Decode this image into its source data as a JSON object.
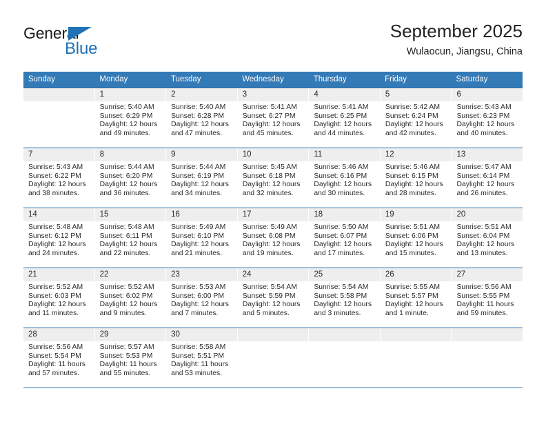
{
  "logo": {
    "word_top": "General",
    "word_bottom": "Blue",
    "triangle_icon": "triangle-icon",
    "accent_color": "#1f72b8"
  },
  "header": {
    "title": "September 2025",
    "subtitle": "Wulaocun, Jiangsu, China"
  },
  "theme": {
    "header_bg": "#337ab7",
    "row_border": "#2b6ea8",
    "day_band_bg": "#eeeeee",
    "text": "#2b2b2b"
  },
  "weekdays": [
    "Sunday",
    "Monday",
    "Tuesday",
    "Wednesday",
    "Thursday",
    "Friday",
    "Saturday"
  ],
  "weeks": [
    {
      "days": [
        {
          "number": "",
          "sunrise": "",
          "sunset": "",
          "daylight_line1": "",
          "daylight_line2": "",
          "empty": true
        },
        {
          "number": "1",
          "sunrise": "Sunrise: 5:40 AM",
          "sunset": "Sunset: 6:29 PM",
          "daylight_line1": "Daylight: 12 hours",
          "daylight_line2": "and 49 minutes."
        },
        {
          "number": "2",
          "sunrise": "Sunrise: 5:40 AM",
          "sunset": "Sunset: 6:28 PM",
          "daylight_line1": "Daylight: 12 hours",
          "daylight_line2": "and 47 minutes."
        },
        {
          "number": "3",
          "sunrise": "Sunrise: 5:41 AM",
          "sunset": "Sunset: 6:27 PM",
          "daylight_line1": "Daylight: 12 hours",
          "daylight_line2": "and 45 minutes."
        },
        {
          "number": "4",
          "sunrise": "Sunrise: 5:41 AM",
          "sunset": "Sunset: 6:25 PM",
          "daylight_line1": "Daylight: 12 hours",
          "daylight_line2": "and 44 minutes."
        },
        {
          "number": "5",
          "sunrise": "Sunrise: 5:42 AM",
          "sunset": "Sunset: 6:24 PM",
          "daylight_line1": "Daylight: 12 hours",
          "daylight_line2": "and 42 minutes."
        },
        {
          "number": "6",
          "sunrise": "Sunrise: 5:43 AM",
          "sunset": "Sunset: 6:23 PM",
          "daylight_line1": "Daylight: 12 hours",
          "daylight_line2": "and 40 minutes."
        }
      ]
    },
    {
      "days": [
        {
          "number": "7",
          "sunrise": "Sunrise: 5:43 AM",
          "sunset": "Sunset: 6:22 PM",
          "daylight_line1": "Daylight: 12 hours",
          "daylight_line2": "and 38 minutes."
        },
        {
          "number": "8",
          "sunrise": "Sunrise: 5:44 AM",
          "sunset": "Sunset: 6:20 PM",
          "daylight_line1": "Daylight: 12 hours",
          "daylight_line2": "and 36 minutes."
        },
        {
          "number": "9",
          "sunrise": "Sunrise: 5:44 AM",
          "sunset": "Sunset: 6:19 PM",
          "daylight_line1": "Daylight: 12 hours",
          "daylight_line2": "and 34 minutes."
        },
        {
          "number": "10",
          "sunrise": "Sunrise: 5:45 AM",
          "sunset": "Sunset: 6:18 PM",
          "daylight_line1": "Daylight: 12 hours",
          "daylight_line2": "and 32 minutes."
        },
        {
          "number": "11",
          "sunrise": "Sunrise: 5:46 AM",
          "sunset": "Sunset: 6:16 PM",
          "daylight_line1": "Daylight: 12 hours",
          "daylight_line2": "and 30 minutes."
        },
        {
          "number": "12",
          "sunrise": "Sunrise: 5:46 AM",
          "sunset": "Sunset: 6:15 PM",
          "daylight_line1": "Daylight: 12 hours",
          "daylight_line2": "and 28 minutes."
        },
        {
          "number": "13",
          "sunrise": "Sunrise: 5:47 AM",
          "sunset": "Sunset: 6:14 PM",
          "daylight_line1": "Daylight: 12 hours",
          "daylight_line2": "and 26 minutes."
        }
      ]
    },
    {
      "days": [
        {
          "number": "14",
          "sunrise": "Sunrise: 5:48 AM",
          "sunset": "Sunset: 6:12 PM",
          "daylight_line1": "Daylight: 12 hours",
          "daylight_line2": "and 24 minutes."
        },
        {
          "number": "15",
          "sunrise": "Sunrise: 5:48 AM",
          "sunset": "Sunset: 6:11 PM",
          "daylight_line1": "Daylight: 12 hours",
          "daylight_line2": "and 22 minutes."
        },
        {
          "number": "16",
          "sunrise": "Sunrise: 5:49 AM",
          "sunset": "Sunset: 6:10 PM",
          "daylight_line1": "Daylight: 12 hours",
          "daylight_line2": "and 21 minutes."
        },
        {
          "number": "17",
          "sunrise": "Sunrise: 5:49 AM",
          "sunset": "Sunset: 6:08 PM",
          "daylight_line1": "Daylight: 12 hours",
          "daylight_line2": "and 19 minutes."
        },
        {
          "number": "18",
          "sunrise": "Sunrise: 5:50 AM",
          "sunset": "Sunset: 6:07 PM",
          "daylight_line1": "Daylight: 12 hours",
          "daylight_line2": "and 17 minutes."
        },
        {
          "number": "19",
          "sunrise": "Sunrise: 5:51 AM",
          "sunset": "Sunset: 6:06 PM",
          "daylight_line1": "Daylight: 12 hours",
          "daylight_line2": "and 15 minutes."
        },
        {
          "number": "20",
          "sunrise": "Sunrise: 5:51 AM",
          "sunset": "Sunset: 6:04 PM",
          "daylight_line1": "Daylight: 12 hours",
          "daylight_line2": "and 13 minutes."
        }
      ]
    },
    {
      "days": [
        {
          "number": "21",
          "sunrise": "Sunrise: 5:52 AM",
          "sunset": "Sunset: 6:03 PM",
          "daylight_line1": "Daylight: 12 hours",
          "daylight_line2": "and 11 minutes."
        },
        {
          "number": "22",
          "sunrise": "Sunrise: 5:52 AM",
          "sunset": "Sunset: 6:02 PM",
          "daylight_line1": "Daylight: 12 hours",
          "daylight_line2": "and 9 minutes."
        },
        {
          "number": "23",
          "sunrise": "Sunrise: 5:53 AM",
          "sunset": "Sunset: 6:00 PM",
          "daylight_line1": "Daylight: 12 hours",
          "daylight_line2": "and 7 minutes."
        },
        {
          "number": "24",
          "sunrise": "Sunrise: 5:54 AM",
          "sunset": "Sunset: 5:59 PM",
          "daylight_line1": "Daylight: 12 hours",
          "daylight_line2": "and 5 minutes."
        },
        {
          "number": "25",
          "sunrise": "Sunrise: 5:54 AM",
          "sunset": "Sunset: 5:58 PM",
          "daylight_line1": "Daylight: 12 hours",
          "daylight_line2": "and 3 minutes."
        },
        {
          "number": "26",
          "sunrise": "Sunrise: 5:55 AM",
          "sunset": "Sunset: 5:57 PM",
          "daylight_line1": "Daylight: 12 hours",
          "daylight_line2": "and 1 minute."
        },
        {
          "number": "27",
          "sunrise": "Sunrise: 5:56 AM",
          "sunset": "Sunset: 5:55 PM",
          "daylight_line1": "Daylight: 11 hours",
          "daylight_line2": "and 59 minutes."
        }
      ]
    },
    {
      "days": [
        {
          "number": "28",
          "sunrise": "Sunrise: 5:56 AM",
          "sunset": "Sunset: 5:54 PM",
          "daylight_line1": "Daylight: 11 hours",
          "daylight_line2": "and 57 minutes."
        },
        {
          "number": "29",
          "sunrise": "Sunrise: 5:57 AM",
          "sunset": "Sunset: 5:53 PM",
          "daylight_line1": "Daylight: 11 hours",
          "daylight_line2": "and 55 minutes."
        },
        {
          "number": "30",
          "sunrise": "Sunrise: 5:58 AM",
          "sunset": "Sunset: 5:51 PM",
          "daylight_line1": "Daylight: 11 hours",
          "daylight_line2": "and 53 minutes."
        },
        {
          "number": "",
          "sunrise": "",
          "sunset": "",
          "daylight_line1": "",
          "daylight_line2": "",
          "empty": true
        },
        {
          "number": "",
          "sunrise": "",
          "sunset": "",
          "daylight_line1": "",
          "daylight_line2": "",
          "empty": true
        },
        {
          "number": "",
          "sunrise": "",
          "sunset": "",
          "daylight_line1": "",
          "daylight_line2": "",
          "empty": true
        },
        {
          "number": "",
          "sunrise": "",
          "sunset": "",
          "daylight_line1": "",
          "daylight_line2": "",
          "empty": true
        }
      ]
    }
  ]
}
